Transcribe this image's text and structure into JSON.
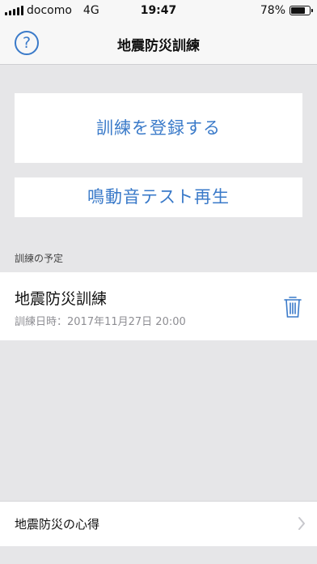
{
  "status": {
    "carrier": "docomo",
    "network": "4G",
    "time": "19:47",
    "battery_percent": "78%",
    "battery_level": 0.78
  },
  "nav": {
    "title": "地震防災訓練",
    "help_icon": "?"
  },
  "actions": {
    "register_label": "訓練を登録する",
    "sound_test_label": "鳴動音テスト再生"
  },
  "schedule": {
    "section_label": "訓練の予定",
    "items": [
      {
        "title": "地震防災訓練",
        "datetime": "訓練日時：2017年11月27日 20:00"
      }
    ]
  },
  "footer": {
    "label": "地震防災の心得"
  },
  "colors": {
    "accent": "#3a7ac9",
    "background": "#e6e6e8",
    "secondary_text": "#8e8e93"
  }
}
